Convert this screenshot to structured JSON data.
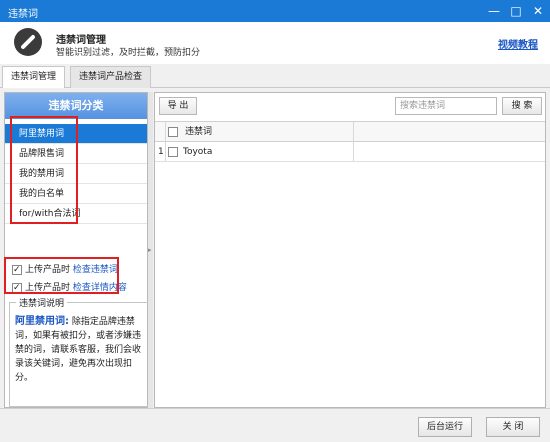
{
  "window": {
    "title": "违禁词",
    "minimize": "—",
    "maximize": "□",
    "close": "✕"
  },
  "header": {
    "title": "违禁词管理",
    "subtitle": "智能识别过滤，及时拦截，预防扣分",
    "video_link": "视频教程"
  },
  "tabs": [
    {
      "label": "违禁词管理",
      "active": true
    },
    {
      "label": "违禁词产品检查",
      "active": false
    }
  ],
  "sidebar": {
    "header": "违禁词分类",
    "items": [
      {
        "label": "阿里禁用词",
        "active": true
      },
      {
        "label": "品牌限售词",
        "active": false
      },
      {
        "label": "我的禁用词",
        "active": false
      },
      {
        "label": "我的白名单",
        "active": false
      },
      {
        "label": "for/with合法词",
        "active": false
      }
    ]
  },
  "options": [
    {
      "prefix": "上传产品时",
      "label": "检查违禁词",
      "checked": true
    },
    {
      "prefix": "上传产品时",
      "label": "检查详情内容",
      "checked": true
    }
  ],
  "description": {
    "title": "违禁词说明",
    "highlight": "阿里禁用词:",
    "text": "除指定品牌违禁词，如果有被扣分，或者涉嫌违禁的词，请联系客服，我们会收录该关键词，避免再次出现扣分。"
  },
  "toolbar": {
    "export_label": "导 出",
    "search_placeholder": "搜索违禁词",
    "search_label": "搜 索"
  },
  "grid": {
    "column_header": "违禁词",
    "rows": [
      {
        "index": "1",
        "word": "Toyota"
      }
    ]
  },
  "footer": {
    "background_label": "后台运行",
    "close_label": "关 闭"
  },
  "colors": {
    "accent": "#1a7ad6",
    "highlight_box": "#e02020",
    "link": "#1a56c4"
  }
}
